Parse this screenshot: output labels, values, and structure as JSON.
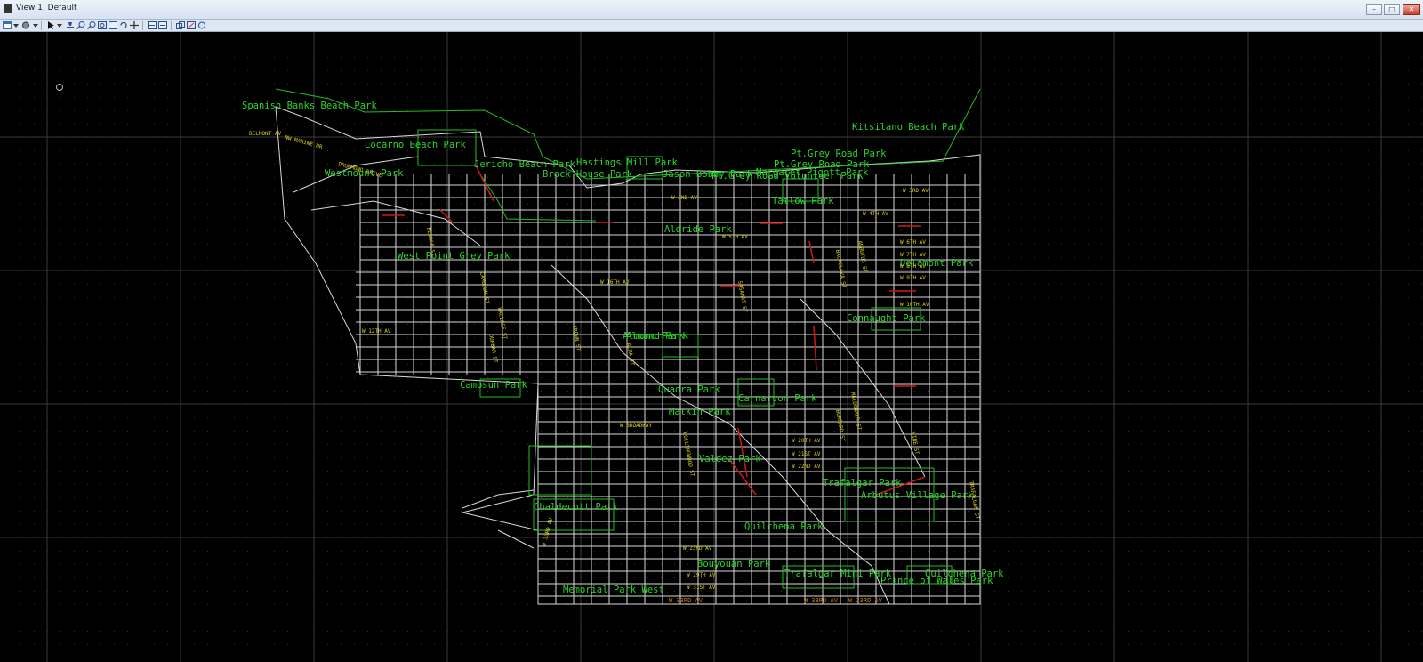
{
  "window": {
    "title": "View 1, Default"
  },
  "toolbar": {
    "icons": [
      "view-attributes-icon",
      "display-style-icon",
      "select-icon",
      "eyedropper-icon",
      "zoom-in-icon",
      "zoom-out-icon",
      "window-area-icon",
      "fit-view-icon",
      "rotate-view-icon",
      "pan-view-icon",
      "view-previous-icon",
      "view-next-icon",
      "clip-volume-icon",
      "clip-mask-icon",
      "camera-icon"
    ]
  },
  "map": {
    "colors": {
      "background": "#000000",
      "street": "#d8d8d8",
      "park": "#1fbf1f",
      "grid": "#3a3a3a"
    },
    "parks": [
      "Spanish Banks Beach Park",
      "Locarno Beach Park",
      "Jericho Beach Park",
      "Hastings Mill Park",
      "Westmount Park",
      "Brock House Park",
      "Jason Bobby Park",
      "Pt.Grey Road Volunteer Park",
      "Kitsilano Beach Park",
      "Pt.Grey Road Park",
      "Pt.Grey Road Park",
      "Margaret Pigott Park",
      "Tatlow Park",
      "Almond Park",
      "Aldride Park",
      "West Point Grey Park",
      "Delamont Park",
      "Connaught Park",
      "Almond Park",
      "Camosun Park",
      "Quadra Park",
      "Carnarvon Park",
      "Malkin Park",
      "Valdez Park",
      "Trafalgar Park",
      "Arbutus Village Park",
      "Chaldecott Park",
      "Quilchena Park",
      "Bouyouan Park",
      "Trafalgar Mini Park",
      "Prince of Wales Park",
      "Quilchena Park",
      "Memorial Park West"
    ],
    "streets": [
      "BELMONT AV",
      "NW MARINE DR",
      "DRUMMOND DRIVE",
      "W 2ND AV",
      "W 3RD AV",
      "W 4TH AV",
      "W 5TH AV",
      "W 6TH AV",
      "W 7TH AV",
      "W 8TH AV",
      "W 9TH AV",
      "W 10TH AV",
      "W 12TH AV",
      "W 16TH AV",
      "W BROADWAY",
      "W 20TH AV",
      "W 21ST AV",
      "W 22ND AV",
      "W 23RD AV",
      "W 29TH AV",
      "W 31ST AV",
      "W 33RD AV",
      "ARBUTUS ST",
      "BALACLAVA ST",
      "MACDONALD ST",
      "VINE ST",
      "TRAFALGAR ST",
      "COLLINGWOOD ST",
      "BLANCA ST",
      "CAMOSUN ST",
      "WALLACE ST",
      "DUNBAR ST",
      "CROWN ST",
      "ALMA ST",
      "SASAMAT ST",
      "BURRARD ST"
    ],
    "orange_labels": [
      "W 33RD AV",
      "W 33RD AV",
      "W 33RD AV"
    ]
  }
}
